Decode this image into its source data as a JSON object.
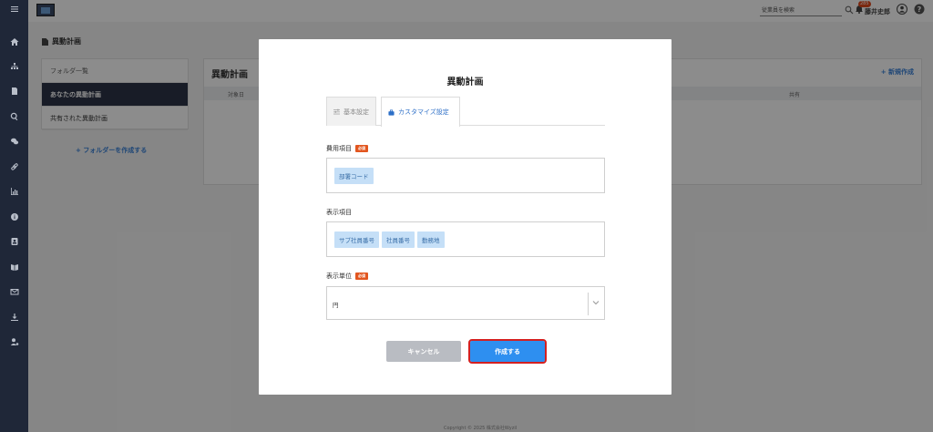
{
  "topbar": {
    "search_placeholder": "従業員を検索",
    "notification_count": "285",
    "user_name": "藤井史郎"
  },
  "page": {
    "title": "異動計画",
    "folders": {
      "header": "フォルダ一覧",
      "items": [
        "あなたの異動計画",
        "共有された異動計画"
      ],
      "add_label": "+ フォルダーを作成する"
    },
    "main": {
      "title": "異動計画",
      "new_label": "+ 新規作成",
      "columns": {
        "target": "対象日",
        "share": "共有"
      }
    },
    "footer": "Copyright © 2025 株式会社Wyzil"
  },
  "modal": {
    "title": "異動計画",
    "tabs": {
      "basic": "基本設定",
      "custom": "カスタマイズ設定"
    },
    "cost_field": {
      "label": "費用項目",
      "required": "必須",
      "chips": [
        "部署コード"
      ]
    },
    "display_field": {
      "label": "表示項目",
      "chips": [
        "サブ社員番号",
        "社員番号",
        "勤務地"
      ]
    },
    "unit_field": {
      "label": "表示単位",
      "required": "必須",
      "value": "円"
    },
    "cancel_label": "キャンセル",
    "create_label": "作成する"
  }
}
